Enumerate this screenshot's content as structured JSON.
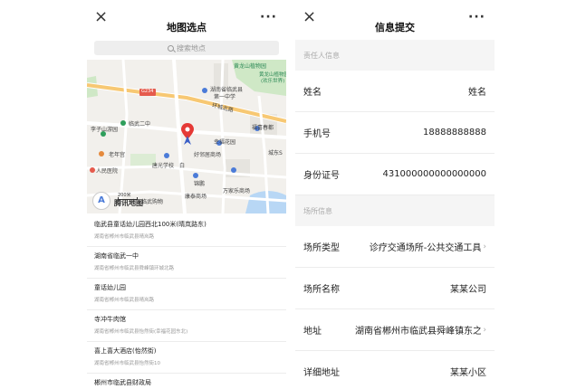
{
  "left_panel": {
    "title": "地图选点",
    "close_icon": "×",
    "more_icon": "···",
    "search_placeholder": "搜索地点",
    "map": {
      "labels": {
        "huanglong": "黄龙山植物园",
        "huanglong_happy": "黄龙山植物园",
        "happy_world": "(欢乐世界)",
        "school1_a": "湖南省临武县",
        "school1_b": "第一中学",
        "g234": "G234",
        "huancheng": "环城北路",
        "linwu2": "临武二中",
        "lizi": "李子山游园",
        "fuqiao": "福喜春都",
        "xinghua": "幸福花园",
        "laonian": "老年宫",
        "haolin": "好邻居商场",
        "chengdong": "城东S",
        "tangguang": "唐光学校",
        "bai": "白",
        "hospital": "人民医院",
        "jinpeng": "锦鹏",
        "kangtai": "康泰商场",
        "wanjia": "万家乐商场",
        "mall": "临武购物",
        "tencent": "腾讯地图",
        "scale": "200米"
      }
    },
    "places": [
      {
        "name": "临武县童话幼儿园西北100米(晴岚路东)",
        "addr": "湖南省郴州市临武县晴岚路"
      },
      {
        "name": "湖南省临武一中",
        "addr": "湖南省郴州市临武县舜峰镇环城北路"
      },
      {
        "name": "童话幼儿园",
        "addr": "湖南省郴州市临武县晴岚路"
      },
      {
        "name": "寺冲牛肉馆",
        "addr": "湖南省郴州市临武县怡然街(幸福花园东北)"
      },
      {
        "name": "喜上喜大酒店(怡然街)",
        "addr": "湖南省郴州市临武县怡然街10"
      },
      {
        "name": "郴州市临武县财政局",
        "addr": ""
      }
    ]
  },
  "right_panel": {
    "title": "信息提交",
    "close_icon": "×",
    "more_icon": "···",
    "section1": "责任人信息",
    "section2": "场所信息",
    "rows1": [
      {
        "label": "姓名",
        "value": "姓名"
      },
      {
        "label": "手机号",
        "value": "18888888888"
      },
      {
        "label": "身份证号",
        "value": "431000000000000000"
      }
    ],
    "rows2": [
      {
        "label": "场所类型",
        "value": "诊疗交通场所-公共交通工具",
        "chevron": "›"
      },
      {
        "label": "场所名称",
        "value": "某某公司"
      },
      {
        "label": "地址",
        "value": "湖南省郴州市临武县舜峰镇东之",
        "chevron": "›"
      },
      {
        "label": "详细地址",
        "value": "某某小区"
      }
    ]
  },
  "colors": {
    "accent": "#4b7bd8",
    "pin": "#e53935",
    "road": "#ffffff",
    "highway": "#f7c873",
    "background": "#f5f5f5"
  }
}
